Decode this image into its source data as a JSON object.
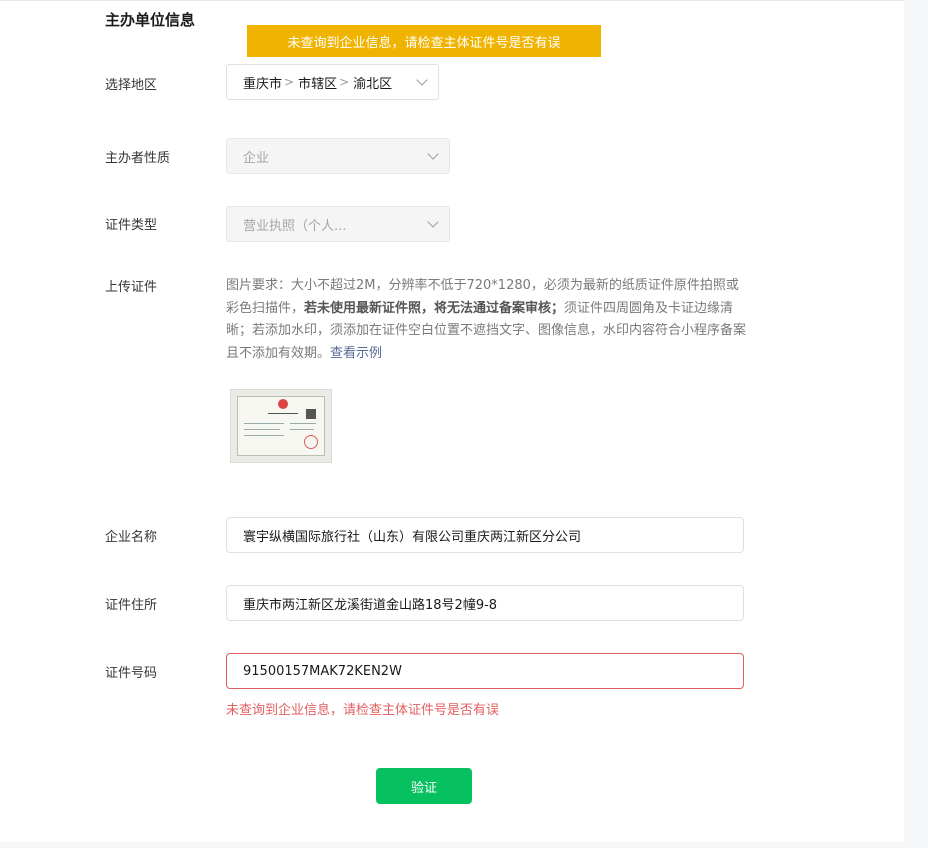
{
  "section": {
    "title": "主办单位信息"
  },
  "toast": {
    "message": "未查询到企业信息，请检查主体证件号是否有误"
  },
  "region": {
    "label": "选择地区",
    "province": "重庆市",
    "city": "市辖区",
    "district": "渝北区"
  },
  "organizer_type": {
    "label": "主办者性质",
    "value": "企业"
  },
  "cert_type": {
    "label": "证件类型",
    "value": "营业执照（个人..."
  },
  "upload": {
    "label": "上传证件",
    "desc_part1": "图片要求：大小不超过2M，分辨率不低于720*1280，必须为最新的纸质证件原件拍照或彩色扫描件，",
    "desc_bold": "若未使用最新证件照，将无法通过备案审核；",
    "desc_part2": "须证件四周圆角及卡证边缘清晰；若添加水印，须添加在证件空白位置不遮挡文字、图像信息，水印内容符合小程序备案且不添加有效期。",
    "example_link": "查看示例"
  },
  "company_name": {
    "label": "企业名称",
    "value": "寰宇纵横国际旅行社（山东）有限公司重庆两江新区分公司"
  },
  "cert_address": {
    "label": "证件住所",
    "value": "重庆市两江新区龙溪街道金山路18号2幢9-8"
  },
  "cert_number": {
    "label": "证件号码",
    "value": "91500157MAK72KEN2W",
    "error": "未查询到企业信息，请检查主体证件号是否有误"
  },
  "verify_button": {
    "label": "验证"
  },
  "colors": {
    "toast": "#f0b400",
    "error": "#e15f5f",
    "primary": "#07c160",
    "link": "#576b95"
  }
}
